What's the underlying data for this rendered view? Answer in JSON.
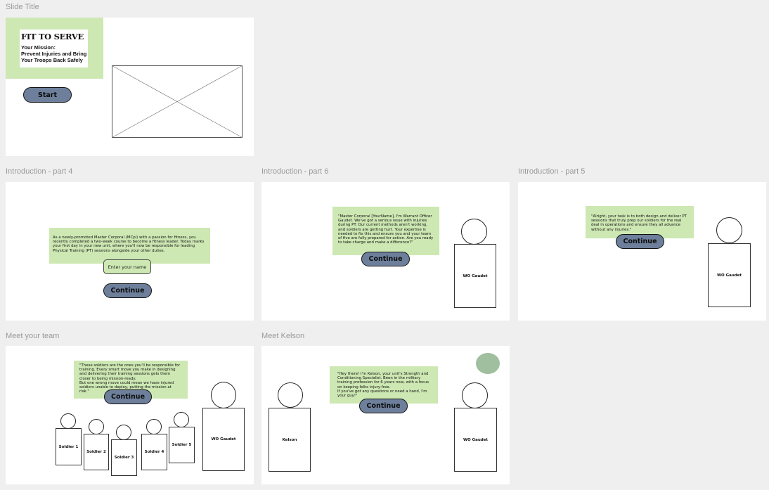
{
  "slides": {
    "slide_title": {
      "label": "Slide Title",
      "game_title": "FIT TO SERVE",
      "mission_line1": "Your Mission:",
      "mission_line2": "Prevent Injuries and Bring",
      "mission_line3": "Your Troops Back Safely",
      "start_label": "Start"
    },
    "intro_4": {
      "label": "Introduction - part 4",
      "dialog": "As a newly-promoted Master Corporal (MCpl) with a passion for fitness, you recently completed a two-week course to become a fitness leader. Today marks your first day in your new unit, where you'll now be responsible for leading Physical Training (PT) sessions alongside your other duties.",
      "name_placeholder": "Enter your name",
      "continue_label": "Continue"
    },
    "intro_6": {
      "label": "Introduction - part 6",
      "dialog": "\"Master Corporal [YourName], I'm Warrant Officer Gaudet. We've got a serious issue with injuries during PT. Our current methods aren't working, and soldiers are getting hurt. Your expertise is needed to fix this and ensure you and your team of five are fully prepared for action. Are you ready to take charge and make a difference?\"",
      "continue_label": "Continue",
      "character_label": "WO Gaudet"
    },
    "intro_5": {
      "label": "Introduction - part 5",
      "dialog": "\"Alright, your task is to both design and deliver PT sessions that truly prep our soldiers for the real deal in operations and ensure they all advance without any injuries.\"",
      "continue_label": "Continue",
      "character_label": "WO Gaudet"
    },
    "meet_team": {
      "label": "Meet your team",
      "dialog": "\"These soldiers are the ones you'll be responsible for training. Every smart move you make in designing and delivering their training sessions gets them closer to being mission-ready.\nBut one wrong move could mean we have injured soldiers unable to deploy, putting the mission at risk.\"",
      "continue_label": "Continue",
      "soldiers": [
        "Soldier 1",
        "Soldier 2",
        "Soldier 3",
        "Soldier 4",
        "Soldier 5"
      ],
      "character_label": "WO Gaudet"
    },
    "meet_kelson": {
      "label": "Meet Kelson",
      "dialog": "\"Hey there! I'm Kelson, your unit's Strength and Conditioning Specialist. Been in the military training profession for 6 years now, with a focus on keeping folks injury-free.\nIf you've got any questions or need a hand, I'm your guy!\"",
      "continue_label": "Continue",
      "kelson_label": "Kelson",
      "character_label": "WO Gaudet"
    }
  },
  "colors": {
    "canvas": "#efefef",
    "frame": "#ffffff",
    "dialog_green": "#cde8b3",
    "button_slate": "#6d7f9b",
    "badge_green": "#9fbf9f"
  }
}
